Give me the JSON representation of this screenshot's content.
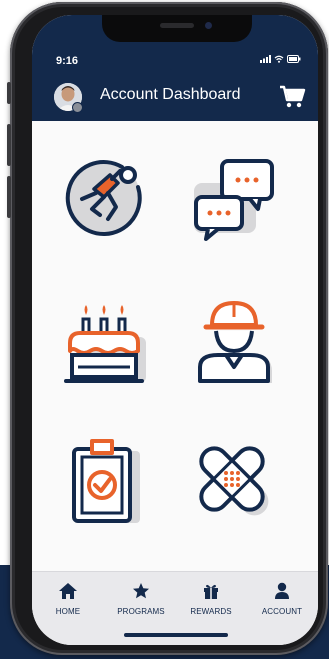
{
  "status_bar": {
    "time": "9:16"
  },
  "header": {
    "title": "Account Dashboard"
  },
  "tiles": [
    {
      "icon": "running-person-icon"
    },
    {
      "icon": "chat-bubbles-icon"
    },
    {
      "icon": "birthday-cake-icon"
    },
    {
      "icon": "construction-worker-icon"
    },
    {
      "icon": "clipboard-check-icon"
    },
    {
      "icon": "bandage-icon"
    }
  ],
  "tabbar": {
    "items": [
      {
        "label": "HOME",
        "icon": "home-icon"
      },
      {
        "label": "PROGRAMS",
        "icon": "star-icon"
      },
      {
        "label": "REWARDS",
        "icon": "gift-icon"
      },
      {
        "label": "ACCOUNT",
        "icon": "person-icon"
      }
    ]
  },
  "colors": {
    "navy": "#13294b",
    "accent": "#e8632b",
    "shadow": "#d7d7d9"
  }
}
